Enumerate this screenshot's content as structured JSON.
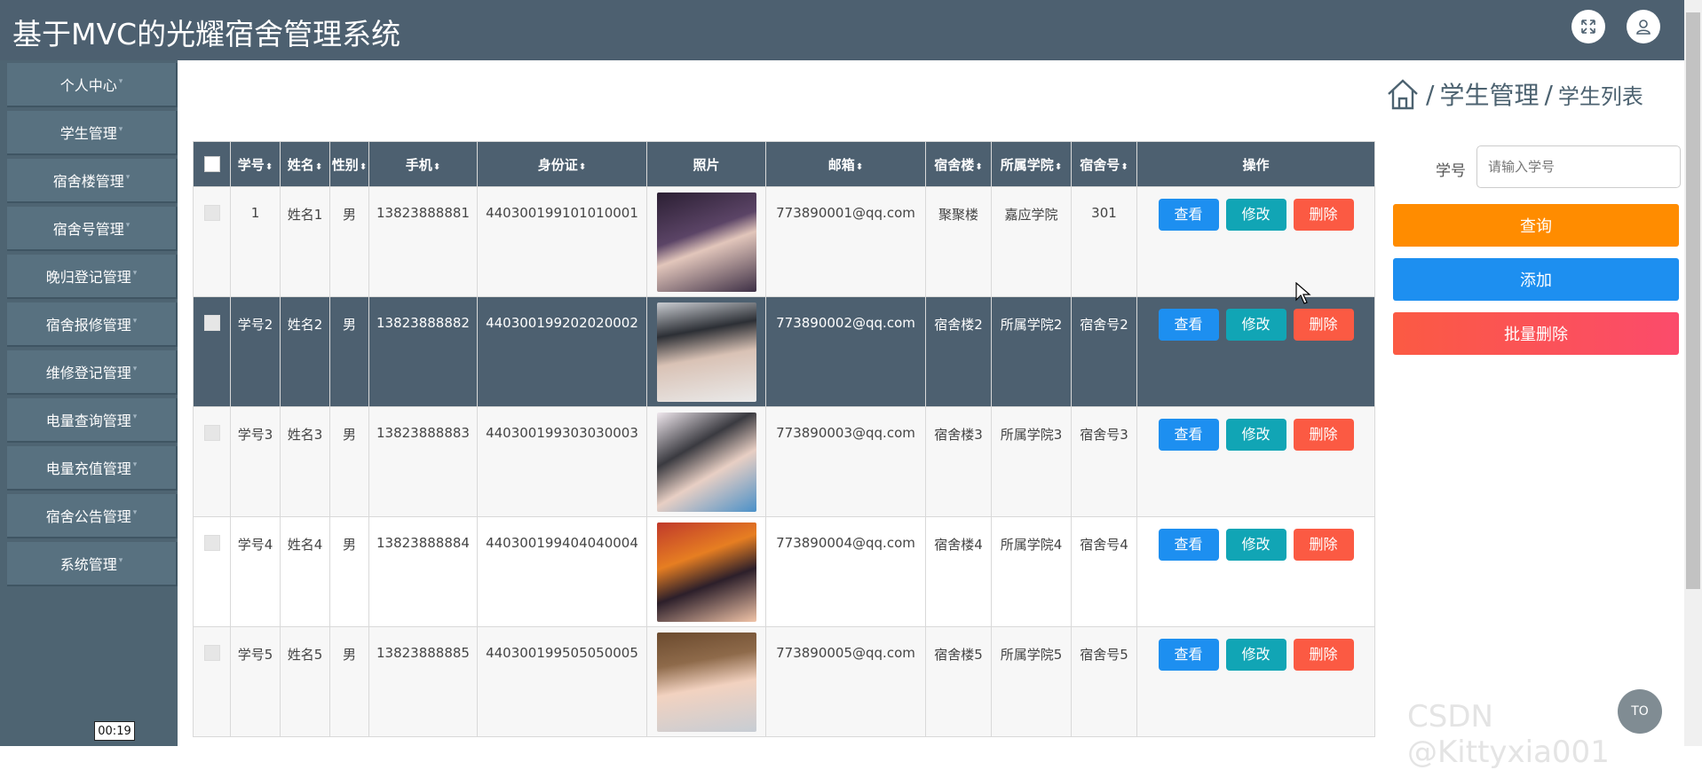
{
  "header": {
    "title": "基于MVC的光耀宿舍管理系统",
    "icons": [
      "fullscreen-icon",
      "user-icon"
    ],
    "background": "#4d6070"
  },
  "sidebar": {
    "items": [
      {
        "label": "个人中心"
      },
      {
        "label": "学生管理"
      },
      {
        "label": "宿舍楼管理"
      },
      {
        "label": "宿舍号管理"
      },
      {
        "label": "晚归登记管理"
      },
      {
        "label": "宿舍报修管理"
      },
      {
        "label": "维修登记管理"
      },
      {
        "label": "电量查询管理"
      },
      {
        "label": "电量充值管理"
      },
      {
        "label": "宿舍公告管理"
      },
      {
        "label": "系统管理"
      }
    ]
  },
  "breadcrumb": {
    "level1": "学生管理",
    "level2": "学生列表",
    "separator": "/"
  },
  "table": {
    "columns": [
      "学号",
      "姓名",
      "性别",
      "手机",
      "身份证",
      "照片",
      "邮箱",
      "宿舍楼",
      "所属学院",
      "宿舍号",
      "操作"
    ],
    "sort_icon": "⬍",
    "rows": [
      {
        "id": "1",
        "name": "姓名1",
        "gender": "男",
        "phone": "13823888881",
        "idcard": "440300199101010001",
        "email": "773890001@qq.com",
        "building": "聚聚楼",
        "college": "嘉应学院",
        "room": "301"
      },
      {
        "id": "学号2",
        "name": "姓名2",
        "gender": "男",
        "phone": "13823888882",
        "idcard": "440300199202020002",
        "email": "773890002@qq.com",
        "building": "宿舍楼2",
        "college": "所属学院2",
        "room": "宿舍号2"
      },
      {
        "id": "学号3",
        "name": "姓名3",
        "gender": "男",
        "phone": "13823888883",
        "idcard": "440300199303030003",
        "email": "773890003@qq.com",
        "building": "宿舍楼3",
        "college": "所属学院3",
        "room": "宿舍号3"
      },
      {
        "id": "学号4",
        "name": "姓名4",
        "gender": "男",
        "phone": "13823888884",
        "idcard": "440300199404040004",
        "email": "773890004@qq.com",
        "building": "宿舍楼4",
        "college": "所属学院4",
        "room": "宿舍号4"
      },
      {
        "id": "学号5",
        "name": "姓名5",
        "gender": "男",
        "phone": "13823888885",
        "idcard": "440300199505050005",
        "email": "773890005@qq.com",
        "building": "宿舍楼5",
        "college": "所属学院5",
        "room": "宿舍号5"
      }
    ],
    "actions": {
      "view": "查看",
      "edit": "修改",
      "delete": "删除"
    }
  },
  "filter": {
    "label": "学号",
    "placeholder": "请输入学号"
  },
  "buttons": {
    "query": "查询",
    "add": "添加",
    "batch_delete": "批量删除"
  },
  "colors": {
    "query": "#ff8c00",
    "add": "#1d8ff0",
    "batch_delete": "#fb5a43",
    "view": "#1d8ff0",
    "edit": "#11a5b5",
    "delete": "#fb5a43"
  },
  "video_time": "00:19",
  "watermark": "CSDN @Kittyxia001",
  "to_top": "TO"
}
